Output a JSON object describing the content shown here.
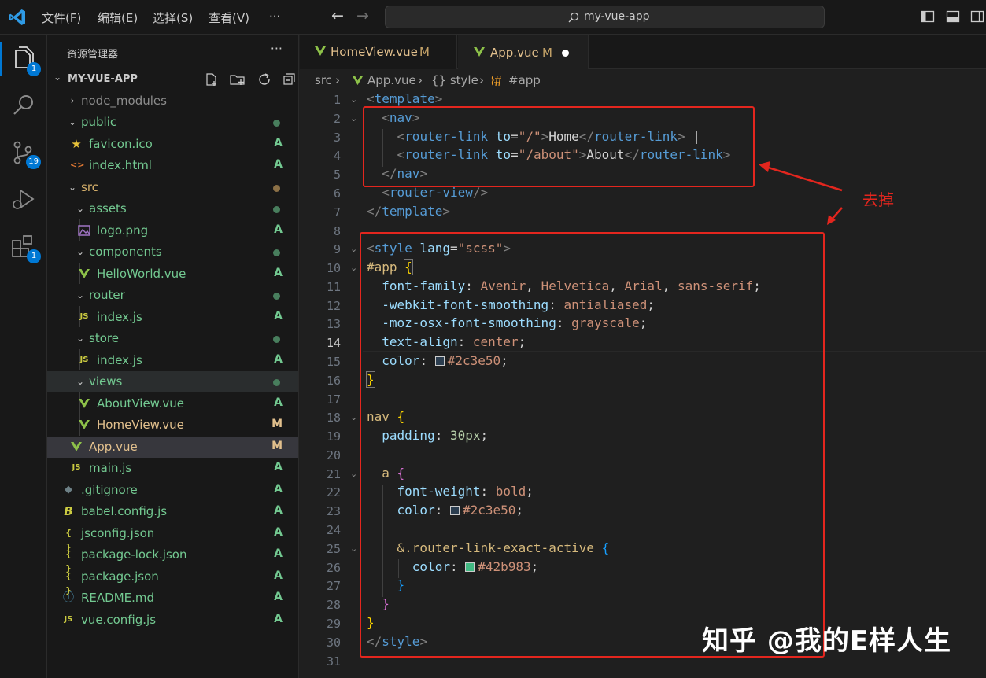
{
  "titlebar": {
    "menus": [
      "文件(F)",
      "编辑(E)",
      "选择(S)",
      "查看(V)",
      "···"
    ],
    "search_text": "my-vue-app"
  },
  "activity": {
    "explorer_badge": "1",
    "scm_badge": "19",
    "extensions_badge": "1"
  },
  "sidebar": {
    "title": "资源管理器",
    "more": "···",
    "project": "MY-VUE-APP",
    "rows": [
      {
        "label": "node_modules",
        "status": ""
      },
      {
        "label": "public",
        "status": ""
      },
      {
        "label": "favicon.ico",
        "status": "A"
      },
      {
        "label": "index.html",
        "status": "A"
      },
      {
        "label": "src",
        "status": ""
      },
      {
        "label": "assets",
        "status": ""
      },
      {
        "label": "logo.png",
        "status": "A"
      },
      {
        "label": "components",
        "status": ""
      },
      {
        "label": "HelloWorld.vue",
        "status": "A"
      },
      {
        "label": "router",
        "status": ""
      },
      {
        "label": "index.js",
        "status": "A"
      },
      {
        "label": "store",
        "status": ""
      },
      {
        "label": "index.js",
        "status": "A"
      },
      {
        "label": "views",
        "status": ""
      },
      {
        "label": "AboutView.vue",
        "status": "A"
      },
      {
        "label": "HomeView.vue",
        "status": "M"
      },
      {
        "label": "App.vue",
        "status": "M"
      },
      {
        "label": "main.js",
        "status": "A"
      },
      {
        "label": ".gitignore",
        "status": "A"
      },
      {
        "label": "babel.config.js",
        "status": "A"
      },
      {
        "label": "jsconfig.json",
        "status": "A"
      },
      {
        "label": "package-lock.json",
        "status": "A"
      },
      {
        "label": "package.json",
        "status": "A"
      },
      {
        "label": "README.md",
        "status": "A"
      },
      {
        "label": "vue.config.js",
        "status": "A"
      }
    ],
    "icon_glyphs": {
      "js": "JS",
      "json": "{ }",
      "html": "<>",
      "info": "ⓘ"
    }
  },
  "tabs": [
    {
      "name": "HomeView.vue",
      "mod": "M"
    },
    {
      "name": "App.vue",
      "mod": "M"
    }
  ],
  "breadcrumb": {
    "src": "src",
    "file": "App.vue",
    "style": "{} style",
    "app": "#app",
    "sep": "›"
  },
  "code": {
    "line_numbers": [
      "1",
      "2",
      "3",
      "4",
      "5",
      "6",
      "7",
      "8",
      "9",
      "10",
      "11",
      "12",
      "13",
      "14",
      "15",
      "16",
      "17",
      "18",
      "19",
      "20",
      "21",
      "22",
      "23",
      "24",
      "25",
      "26",
      "27",
      "28",
      "29",
      "30",
      "31"
    ],
    "current_line": 14,
    "color_dark": "#2c3e50",
    "color_green": "#42b983"
  },
  "annotation": {
    "note": "去掉",
    "watermark": "知乎 @我的E样人生"
  }
}
